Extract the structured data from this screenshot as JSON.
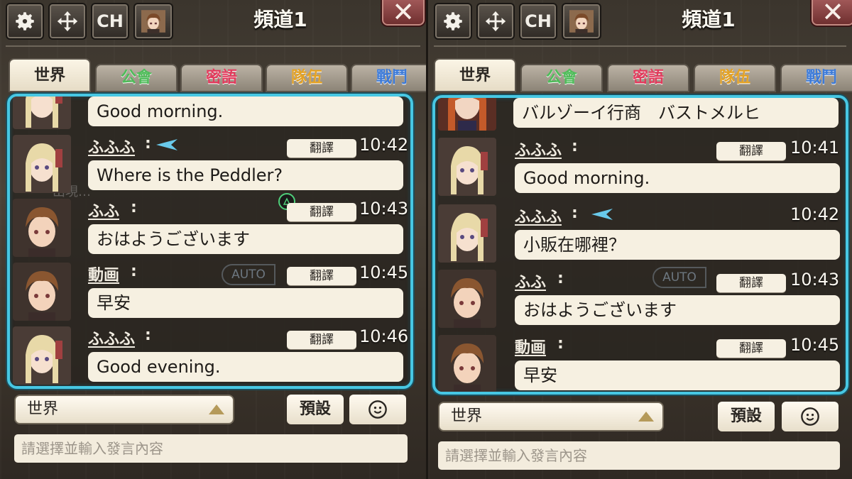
{
  "toolbar": {
    "ch_label": "CH"
  },
  "channel_title": "頻道1",
  "close_label": "✕",
  "tabs": [
    {
      "label": "世界",
      "color": "#2d2924"
    },
    {
      "label": "公會",
      "color": "#4fbc5a"
    },
    {
      "label": "密語",
      "color": "#e23a5c"
    },
    {
      "label": "隊伍",
      "color": "#e4a224"
    },
    {
      "label": "戰鬥",
      "color": "#3c7ad8"
    }
  ],
  "translate_label": "翻譯",
  "left_messages": [
    {
      "sender": "",
      "time": "",
      "text": "Good morning."
    },
    {
      "sender": "ふふふ",
      "time": "10:42",
      "text": "Where is the Peddler?"
    },
    {
      "sender": "ふふ",
      "time": "10:43",
      "text": "おはようございます"
    },
    {
      "sender": "動画",
      "time": "10:45",
      "text": "早安"
    },
    {
      "sender": "ふふふ",
      "time": "10:46",
      "text": "Good evening."
    }
  ],
  "right_messages": [
    {
      "sender": "",
      "time": "",
      "text": "バルゾーイ行商　バストメルヒ"
    },
    {
      "sender": "ふふふ",
      "time": "10:41",
      "text": "Good morning."
    },
    {
      "sender": "ふふふ",
      "time": "10:42",
      "text": "小販在哪裡？"
    },
    {
      "sender": "ふふ",
      "time": "10:43",
      "text": "おはようございます"
    },
    {
      "sender": "動画",
      "time": "10:45",
      "text": "早安"
    }
  ],
  "bottom": {
    "channel_select_value": "世界",
    "preset_label": "預設",
    "input_placeholder": "請選擇並輸入發言內容"
  },
  "background": {
    "auto_label": "AUTO"
  },
  "colors": {
    "accent_border": "#47c7e3",
    "bubble": "#f6f0e1",
    "marker": "#69c9ea"
  }
}
